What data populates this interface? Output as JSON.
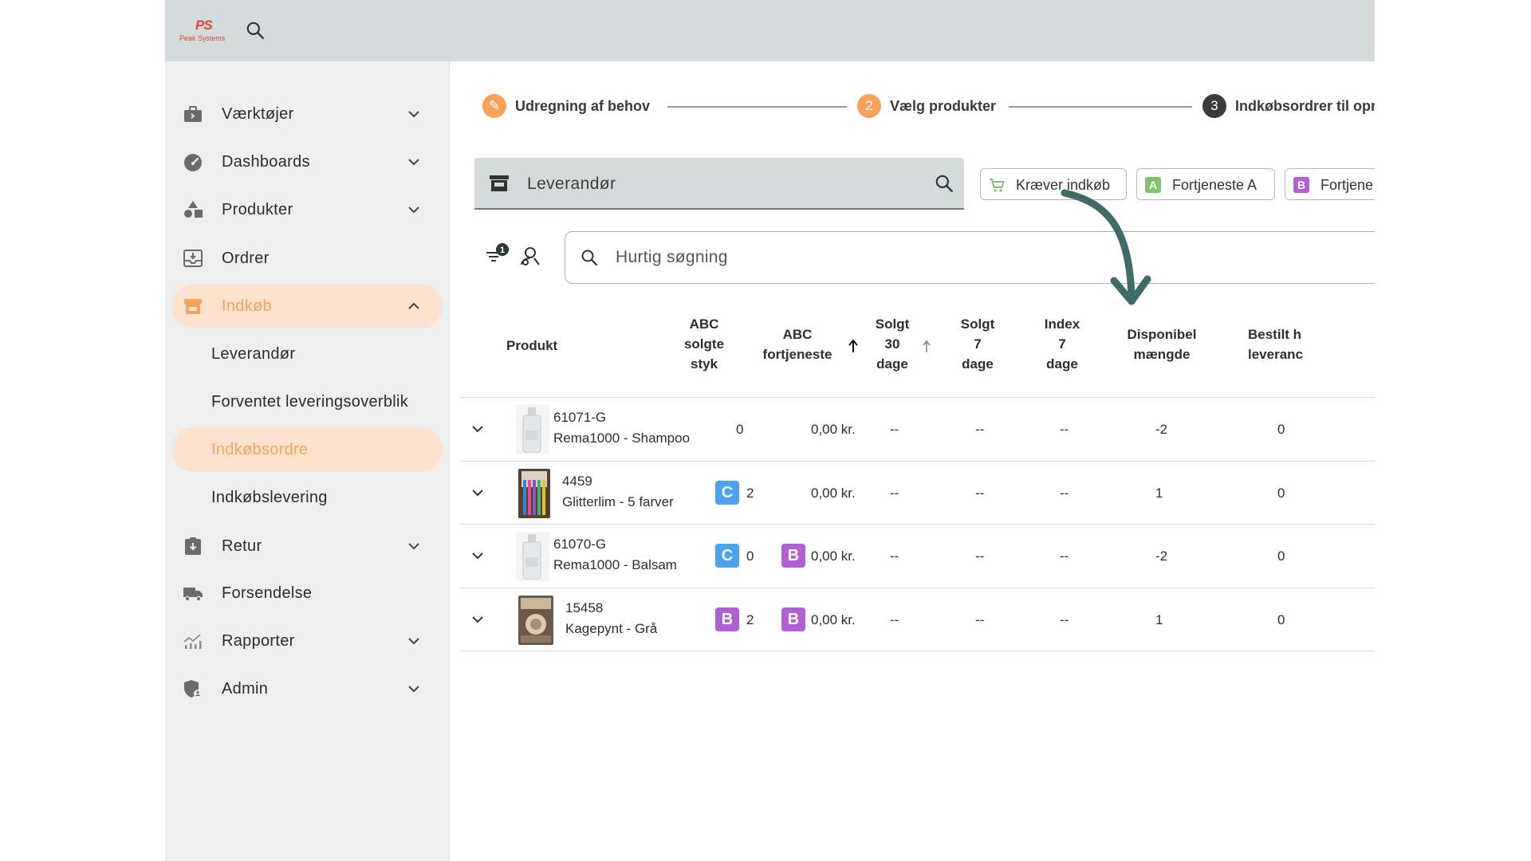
{
  "app": {
    "logo_mark": "PS",
    "logo_sub": "Peak Systems"
  },
  "sidebar": {
    "items": [
      {
        "label": "Værktøjer",
        "icon": "toolbox-icon"
      },
      {
        "label": "Dashboards",
        "icon": "speedometer-icon"
      },
      {
        "label": "Produkter",
        "icon": "shapes-icon"
      },
      {
        "label": "Ordrer",
        "icon": "inbox-icon"
      },
      {
        "label": "Indkøb",
        "icon": "storefront-icon"
      },
      {
        "label": "Retur",
        "icon": "clipboard-return-icon"
      },
      {
        "label": "Forsendelse",
        "icon": "truck-icon"
      },
      {
        "label": "Rapporter",
        "icon": "chart-icon"
      },
      {
        "label": "Admin",
        "icon": "shield-person-icon"
      }
    ],
    "submenu": [
      {
        "label": "Leverandør"
      },
      {
        "label": "Forventet leveringsoverblik"
      },
      {
        "label": "Indkøbsordre"
      },
      {
        "label": "Indkøbslevering"
      }
    ]
  },
  "stepper": {
    "step1": {
      "label": "Udregning af behov",
      "symbol": "✎"
    },
    "step2": {
      "label": "Vælg produkter",
      "number": "2"
    },
    "step3": {
      "label": "Indkøbsordrer til opre",
      "number": "3"
    }
  },
  "supplier": {
    "label": "Leverandør"
  },
  "chips": {
    "needs_purchase": "Kræver indkøb",
    "profit_a": {
      "label": "Fortjeneste A",
      "letter": "A"
    },
    "profit_b": {
      "label": "Fortjene",
      "letter": "B"
    }
  },
  "filter": {
    "count": "1"
  },
  "search": {
    "placeholder": "Hurtig søgning"
  },
  "table": {
    "headers": {
      "product": [
        "Produkt"
      ],
      "abc_sold": [
        "ABC",
        "solgte",
        "styk"
      ],
      "abc_profit": [
        "ABC",
        "fortjeneste"
      ],
      "sold30": [
        "Solgt",
        "30",
        "dage"
      ],
      "sold7": [
        "Solgt",
        "7",
        "dage"
      ],
      "index7": [
        "Index",
        "7",
        "dage"
      ],
      "available": [
        "Disponibel",
        "mængde"
      ],
      "ordered": [
        "Bestilt h",
        "leveranc"
      ]
    },
    "rows": [
      {
        "number": "61071-G",
        "name": "Rema1000 - Shampoo",
        "abc_sold_badge": "",
        "abc_sold": "0",
        "abc_profit_badge": "",
        "abc_profit": "0,00 kr.",
        "sold30": "--",
        "sold7": "--",
        "index7": "--",
        "available": "-2",
        "ordered": "0"
      },
      {
        "number": "4459",
        "name": "Glitterlim - 5 farver",
        "abc_sold_badge": "C",
        "abc_sold": "2",
        "abc_profit_badge": "",
        "abc_profit": "0,00 kr.",
        "sold30": "--",
        "sold7": "--",
        "index7": "--",
        "available": "1",
        "ordered": "0"
      },
      {
        "number": "61070-G",
        "name": "Rema1000 - Balsam",
        "abc_sold_badge": "C",
        "abc_sold": "0",
        "abc_profit_badge": "B",
        "abc_profit": "0,00 kr.",
        "sold30": "--",
        "sold7": "--",
        "index7": "--",
        "available": "-2",
        "ordered": "0"
      },
      {
        "number": "15458",
        "name": "Kagepynt - Grå",
        "abc_sold_badge": "B",
        "abc_sold": "2",
        "abc_profit_badge": "B",
        "abc_profit": "0,00 kr.",
        "sold30": "--",
        "sold7": "--",
        "index7": "--",
        "available": "1",
        "ordered": "0"
      }
    ]
  },
  "colors": {
    "accent_orange": "#f6a25a",
    "badge_c": "#4aa3f0",
    "badge_b": "#b05fd4",
    "badge_a": "#7fc46b",
    "arrow": "#3f6b68"
  }
}
